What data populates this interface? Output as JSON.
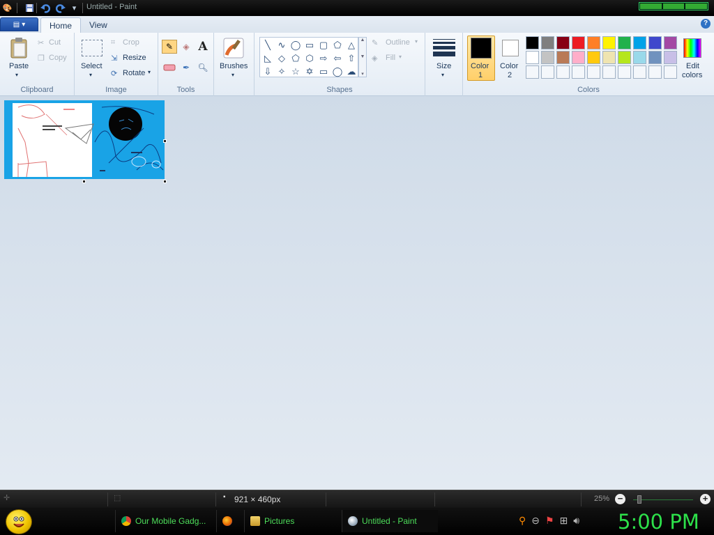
{
  "window": {
    "title": "Untitled - Paint"
  },
  "tabs": {
    "home": "Home",
    "view": "View"
  },
  "help_label": "?",
  "clipboard": {
    "paste": "Paste",
    "cut": "Cut",
    "copy": "Copy",
    "group": "Clipboard"
  },
  "image": {
    "select": "Select",
    "crop": "Crop",
    "resize": "Resize",
    "rotate": "Rotate",
    "group": "Image"
  },
  "tools": {
    "group": "Tools",
    "text_tool": "A"
  },
  "brushes": {
    "label": "Brushes"
  },
  "shapes": {
    "outline": "Outline",
    "fill": "Fill",
    "group": "Shapes"
  },
  "size": {
    "label": "Size"
  },
  "colors": {
    "color1_line1": "Color",
    "color1_line2": "1",
    "color2_line1": "Color",
    "color2_line2": "2",
    "edit_line1": "Edit",
    "edit_line2": "colors",
    "group": "Colors",
    "color1": "#000000",
    "color2": "#ffffff",
    "row1": [
      "#000000",
      "#7f7f7f",
      "#880015",
      "#ed1c24",
      "#ff7f27",
      "#fff200",
      "#22b14c",
      "#00a2e8",
      "#3f48cc",
      "#a349a4"
    ],
    "row2": [
      "#ffffff",
      "#c3c3c3",
      "#b97a57",
      "#ffaec9",
      "#ffc90e",
      "#efe4b0",
      "#b5e61d",
      "#99d9ea",
      "#7092be",
      "#c8bfe7"
    ]
  },
  "status": {
    "dimensions": "921 × 460px",
    "zoom": "25%"
  },
  "taskbar": {
    "tasks": [
      {
        "label": "Our Mobile Gadg...",
        "icon": "chrome-icon"
      },
      {
        "label": "",
        "icon": "firefox-icon"
      },
      {
        "label": "Pictures",
        "icon": "folder-icon"
      },
      {
        "label": "Untitled - Paint",
        "icon": "paint-icon"
      }
    ],
    "clock": "5:00 PM"
  }
}
